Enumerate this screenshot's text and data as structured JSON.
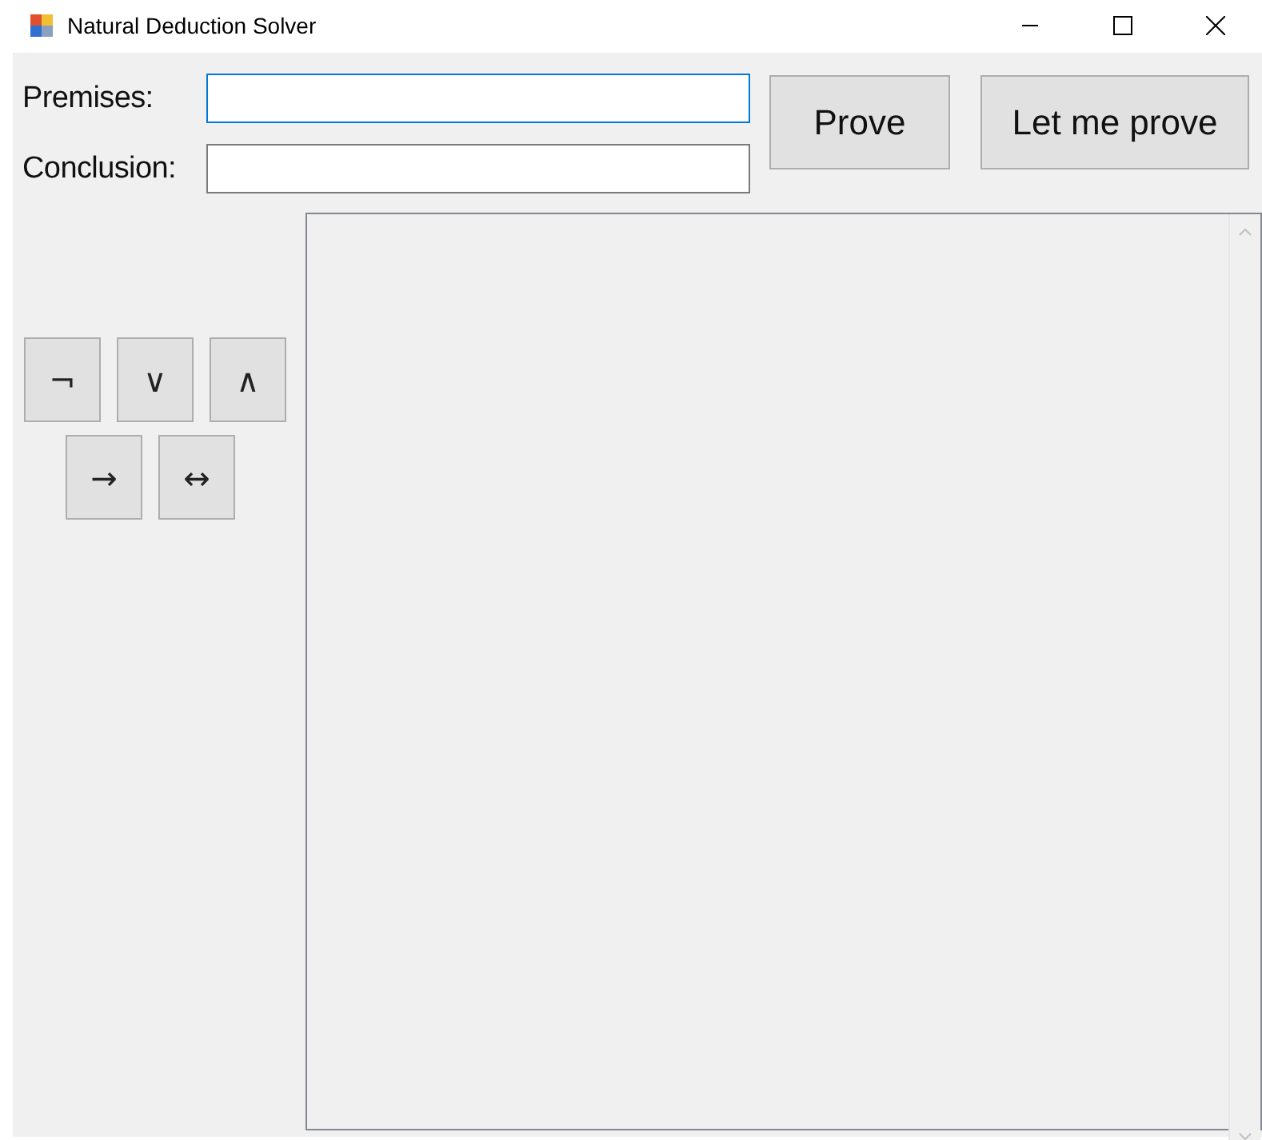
{
  "window": {
    "title": "Natural Deduction Solver"
  },
  "fields": [
    {
      "label": "Premises:",
      "focused": true
    },
    {
      "label": "Conclusion:",
      "focused": false
    }
  ],
  "buttons": [
    "Prove",
    "Let me prove"
  ],
  "symbol_rows": [
    [
      "¬",
      "∨",
      "∧"
    ],
    [
      "→",
      "↔"
    ]
  ]
}
